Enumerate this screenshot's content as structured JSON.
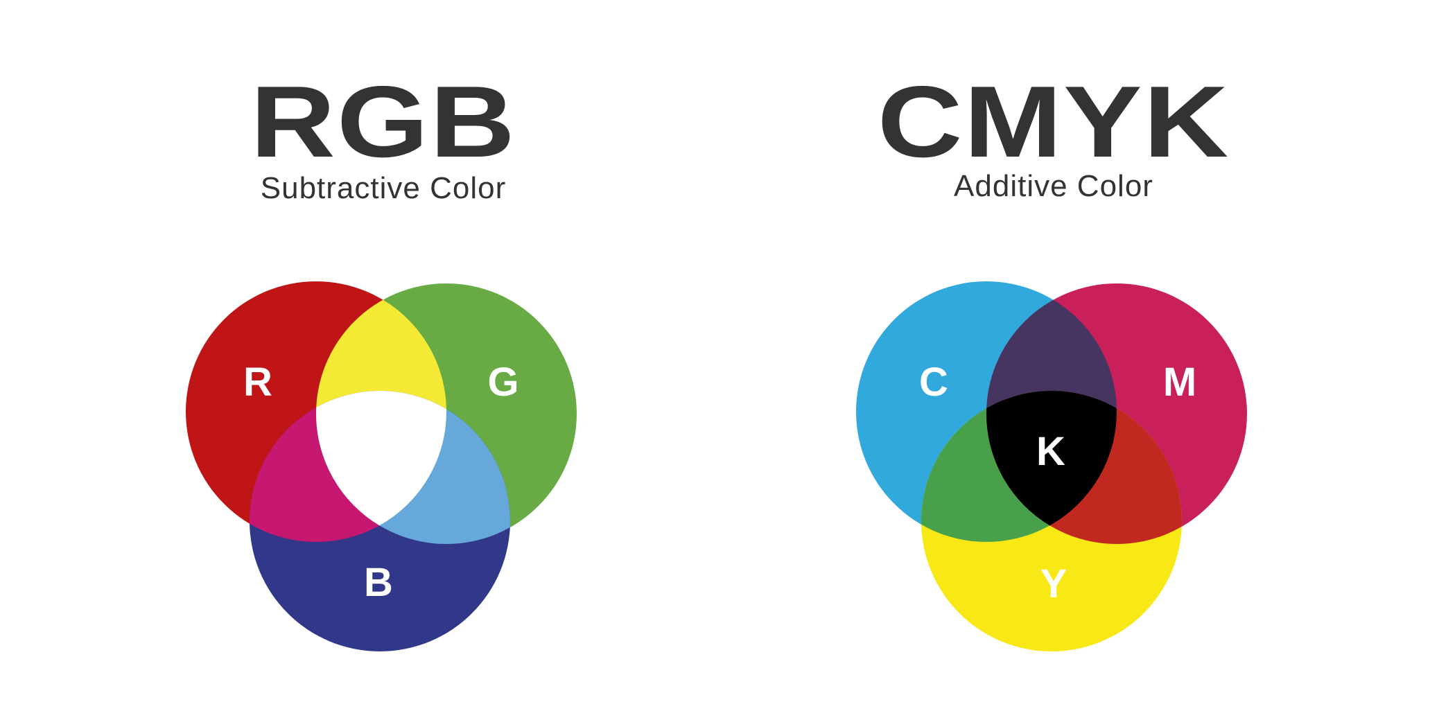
{
  "rgb": {
    "title": "RGB",
    "subtitle": "Subtractive Color",
    "labels": {
      "r": "R",
      "g": "G",
      "b": "B"
    },
    "colors": {
      "red": "#c01517",
      "green": "#68ab44",
      "blue": "#313889",
      "red_green": "#f4e934",
      "red_blue": "#c61870",
      "green_blue": "#66a8da",
      "center": "#ffffff"
    }
  },
  "cmyk": {
    "title": "CMYK",
    "subtitle": "Additive Color",
    "labels": {
      "c": "C",
      "m": "M",
      "y": "Y",
      "k": "K"
    },
    "colors": {
      "cyan": "#32a9dc",
      "magenta": "#c9205c",
      "yellow": "#f7e816",
      "cyan_magenta": "#473561",
      "cyan_yellow": "#48a04a",
      "magenta_yellow": "#c1281f",
      "center": "#000000"
    }
  }
}
